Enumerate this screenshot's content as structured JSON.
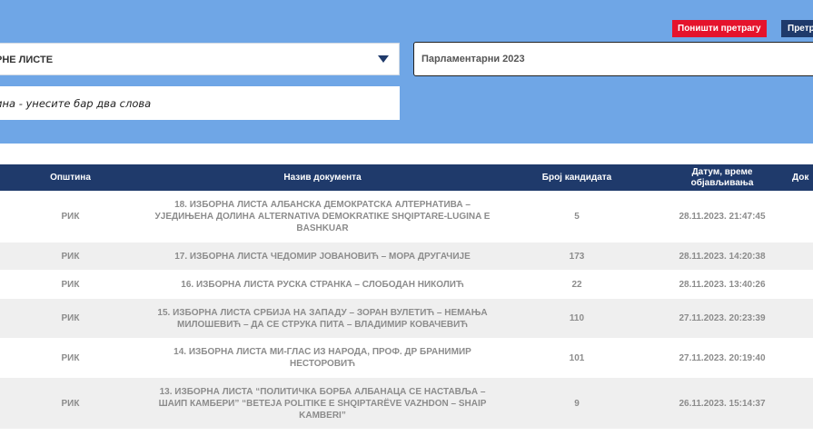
{
  "toolbar": {
    "reset_label": "Поништи претрагу",
    "search_label": "Претражи"
  },
  "filters": {
    "list_type_value": "РНЕ ЛИСТЕ",
    "election_value": "Парламентарни 2023",
    "municipality_placeholder": "ина - унесите бар два слова"
  },
  "table": {
    "headers": {
      "municipality": "Општина",
      "document": "Назив документа",
      "candidates": "Број кандидата",
      "datetime": "Датум, време објављивања",
      "doc": "Док"
    },
    "rows": [
      {
        "municipality": "РИК",
        "document": "18. ИЗБОРНА ЛИСТА АЛБАНСКА ДЕМОКРАТСКА АЛТЕРНАТИВА – УЈЕДИЊЕНА ДОЛИНА ALTERNATIVA DEMOKRATIKE SHQIPTARE-LUGINA E BASHKUAR",
        "candidates": "5",
        "datetime": "28.11.2023. 21:47:45"
      },
      {
        "municipality": "РИК",
        "document": "17. ИЗБОРНА ЛИСТА ЧЕДОМИР ЈОВАНОВИЋ – МОРА ДРУГАЧИЈЕ",
        "candidates": "173",
        "datetime": "28.11.2023. 14:20:38"
      },
      {
        "municipality": "РИК",
        "document": "16. ИЗБОРНА ЛИСТА РУСКА СТРАНКА – СЛОБОДАН НИКОЛИЋ",
        "candidates": "22",
        "datetime": "28.11.2023. 13:40:26"
      },
      {
        "municipality": "РИК",
        "document": "15. ИЗБОРНА ЛИСТА СРБИЈА НА ЗАПАДУ – ЗОРАН ВУЛЕТИЋ – НЕМАЊА МИЛОШЕВИЋ – ДА СЕ СТРУКА ПИТА – ВЛАДИМИР КОВАЧЕВИЋ",
        "candidates": "110",
        "datetime": "27.11.2023. 20:23:39"
      },
      {
        "municipality": "РИК",
        "document": "14. ИЗБОРНА ЛИСТА МИ-ГЛАС ИЗ НАРОДА, ПРОФ. ДР БРАНИМИР НЕСТОРОВИЋ",
        "candidates": "101",
        "datetime": "27.11.2023. 20:19:40"
      },
      {
        "municipality": "РИК",
        "document": "13. ИЗБОРНА ЛИСТА “ПОЛИТИЧКА БОРБА АЛБАНАЦА СЕ НАСТАВЉА – ШАИП КАМБЕРИ” “BETEJA POLITIKE E SHQIPTARËVE VAZHDON – SHAIP KAMBERI”",
        "candidates": "9",
        "datetime": "26.11.2023. 15:14:37"
      }
    ]
  },
  "colors": {
    "panel_bg": "#6fa6e6",
    "header_bg": "#1f3a6b",
    "reset_button": "#e5132c",
    "row_alt": "#efefef",
    "cell_text": "#8c8c8c"
  }
}
